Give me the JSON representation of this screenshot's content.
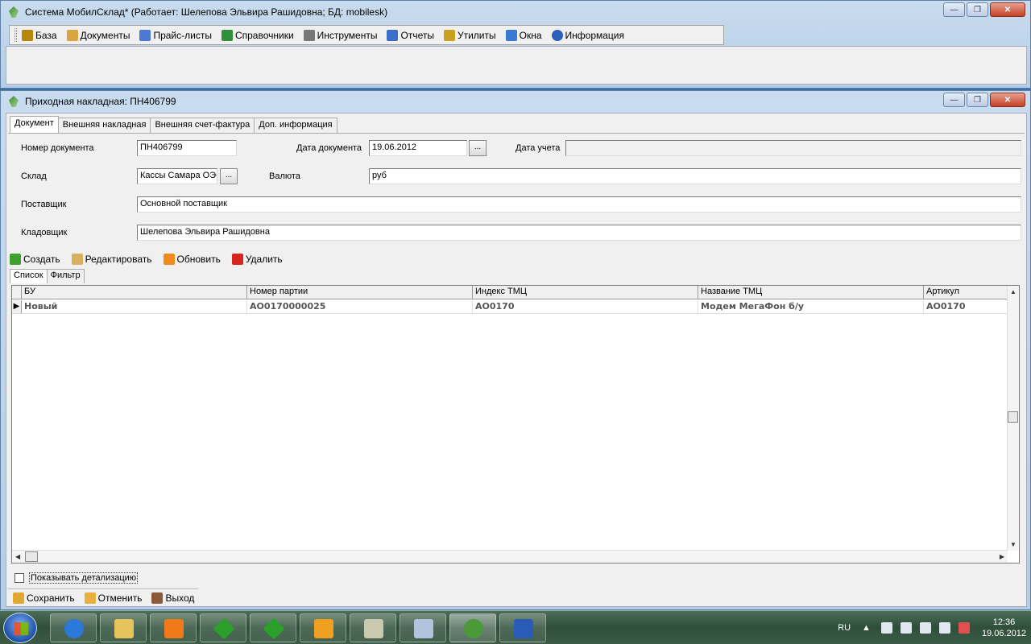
{
  "main_window": {
    "title": "Система МобилСклад* (Работает: Шелепова Эльвира Рашидовна; БД: mobilesk)",
    "menu": [
      {
        "label": "База",
        "icon": "book-icon",
        "color": "#b8860b"
      },
      {
        "label": "Документы",
        "icon": "documents-icon",
        "color": "#d9a441"
      },
      {
        "label": "Прайс-листы",
        "icon": "people-icon",
        "color": "#4a7bd0"
      },
      {
        "label": "Справочники",
        "icon": "green-book-icon",
        "color": "#2f8f3a"
      },
      {
        "label": "Инструменты",
        "icon": "tools-icon",
        "color": "#777777"
      },
      {
        "label": "Отчеты",
        "icon": "report-icon",
        "color": "#3b6fc7"
      },
      {
        "label": "Утилиты",
        "icon": "wand-icon",
        "color": "#c9a020"
      },
      {
        "label": "Окна",
        "icon": "windows-icon",
        "color": "#3a7ad0"
      },
      {
        "label": "Информация",
        "icon": "info-icon",
        "color": "#2d5fb8"
      }
    ]
  },
  "doc_window": {
    "title": "Приходная накладная: ПН406799",
    "tabs": [
      "Документ",
      "Внешняя накладная",
      "Внешняя счет-фактура",
      "Доп. информация"
    ],
    "form": {
      "doc_number_label": "Номер документа",
      "doc_number": "ПН406799",
      "doc_date_label": "Дата документа",
      "doc_date": "19.06.2012",
      "account_date_label": "Дата учета",
      "account_date": "",
      "warehouse_label": "Склад",
      "warehouse": "Кассы Самара ОЭС",
      "currency_label": "Валюта",
      "currency": "руб",
      "supplier_label": "Поставщик",
      "supplier": "Основной поставщик",
      "storekeeper_label": "Кладовщик",
      "storekeeper": "Шелепова Эльвира Рашидовна",
      "dots": "..."
    },
    "toolbar": {
      "create": "Создать",
      "edit": "Редактировать",
      "refresh": "Обновить",
      "delete": "Удалить"
    },
    "subtabs": [
      "Список",
      "Фильтр"
    ],
    "grid": {
      "columns": [
        "БУ",
        "Номер партии",
        "Индекс ТМЦ",
        "Название ТМЦ",
        "Артикул"
      ],
      "rows": [
        [
          "Новый",
          "AO0170000025",
          "AO0170",
          "Модем МегаФон б/у",
          "AO0170"
        ]
      ]
    },
    "show_details": "Показывать детализацию",
    "bottom": {
      "save": "Сохранить",
      "cancel": "Отменить",
      "exit": "Выход"
    }
  },
  "taskbar": {
    "lang": "RU",
    "time": "12:36",
    "date": "19.06.2012"
  }
}
